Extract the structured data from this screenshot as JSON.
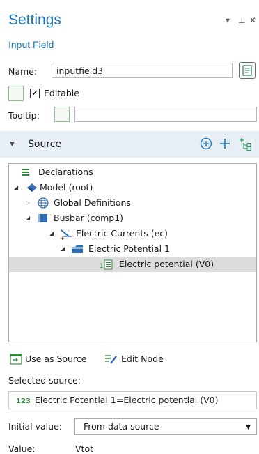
{
  "header": {
    "title": "Settings",
    "subtitle": "Input Field",
    "controls": {
      "menu": "▾",
      "pin": "⊥",
      "close": "✕"
    }
  },
  "form": {
    "name_label": "Name:",
    "name_value": "inputfield3",
    "editable_label": "Editable",
    "editable_checked": true,
    "tooltip_label": "Tooltip:",
    "tooltip_value": ""
  },
  "source": {
    "title": "Source",
    "tree": [
      {
        "label": "Declarations",
        "icon": "declarations-icon"
      },
      {
        "label": "Model (root)",
        "icon": "model-icon"
      },
      {
        "label": "Global Definitions",
        "icon": "globe-icon"
      },
      {
        "label": "Busbar (comp1)",
        "icon": "component-icon"
      },
      {
        "label": "Electric Currents (ec)",
        "icon": "electric-currents-icon"
      },
      {
        "label": "Electric Potential 1",
        "icon": "boundary-icon"
      },
      {
        "label": "Electric potential (V0)",
        "icon": "parameter-icon"
      }
    ]
  },
  "actions": {
    "use_as_source": "Use as Source",
    "edit_node": "Edit Node"
  },
  "selected": {
    "label": "Selected source:",
    "prefix": "123",
    "value": "Electric Potential 1=Electric potential (V0)"
  },
  "initial": {
    "label": "Initial value:",
    "selected_option": "From data source"
  },
  "value": {
    "label": "Value:",
    "text": "Vtot"
  },
  "colors": {
    "accent": "#1d77b8",
    "section_bg": "#e7eef5",
    "selected_row": "#dcdcdc",
    "add_icon_green": "#2e9e5b"
  }
}
